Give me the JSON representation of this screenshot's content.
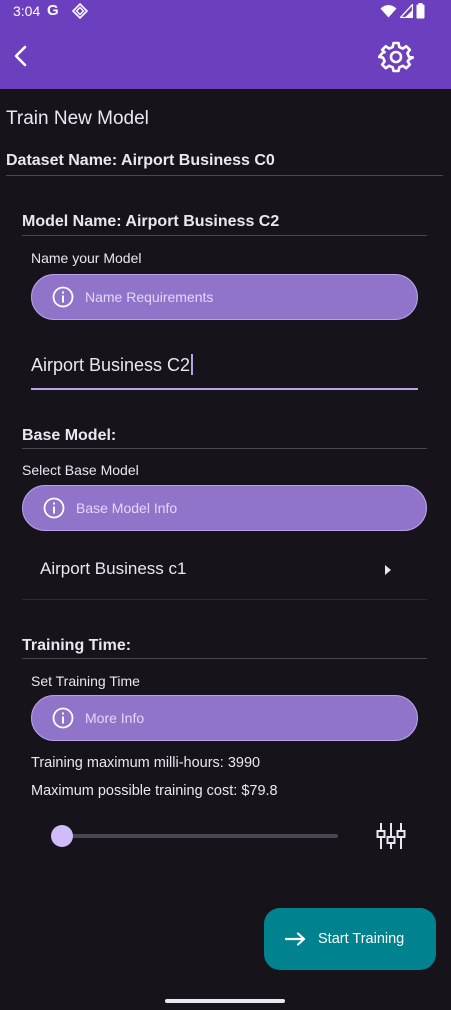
{
  "status_bar": {
    "time": "3:04",
    "left_icons": [
      "google-g-icon",
      "system-notification-icon"
    ],
    "right_icons": [
      "wifi-icon",
      "signal-icon",
      "battery-icon"
    ],
    "g_glyph": "G"
  },
  "app_bar": {
    "background": "#6c3fbf",
    "back_icon": "chevron-left-icon",
    "settings_icon": "gear-icon"
  },
  "page": {
    "title": "Train New Model",
    "dataset_name": "Dataset Name: Airport Business C0"
  },
  "model_name_section": {
    "heading": "Model Name: Airport Business C2",
    "field_label": "Name your Model",
    "info_button": "Name Requirements",
    "input_value": "Airport Business C2"
  },
  "base_model_section": {
    "heading": "Base Model:",
    "field_label": "Select Base Model",
    "info_button": "Base Model Info",
    "selected_value": "Airport Business c1"
  },
  "training_time_section": {
    "heading": "Training Time:",
    "field_label": "Set Training Time",
    "info_button": "More Info",
    "max_milli_hours": "Training maximum milli-hours: 3990",
    "max_cost": "Maximum possible training cost: $79.8",
    "slider_position": 0.0
  },
  "fab": {
    "label": "Start Training",
    "color": "#00838f"
  },
  "colors": {
    "accent": "#6c3fbf",
    "pill": "#9074c9",
    "background": "#16131a"
  }
}
